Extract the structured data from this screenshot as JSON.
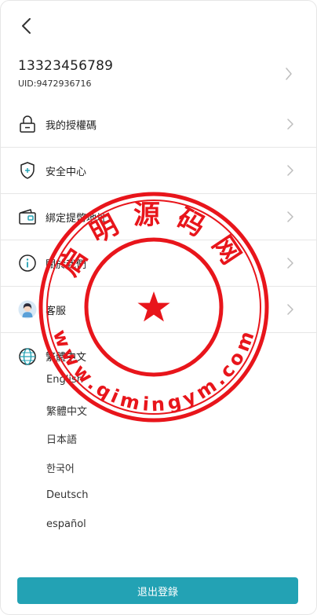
{
  "profile": {
    "phone": "13323456789",
    "uid": "UID:9472936716"
  },
  "menu": [
    {
      "label": "我的授權碼",
      "icon": "lock-icon"
    },
    {
      "label": "安全中心",
      "icon": "shield-icon"
    },
    {
      "label": "綁定提幣地址",
      "icon": "wallet-icon"
    },
    {
      "label": "關於我們",
      "icon": "info-icon"
    },
    {
      "label": "客服",
      "icon": "support-avatar-icon"
    }
  ],
  "language": {
    "current": "繁體中文",
    "icon": "globe-icon",
    "options": [
      "English",
      "繁體中文",
      "日本語",
      "한국어",
      "Deutsch",
      "español"
    ]
  },
  "logout_label": "退出登錄",
  "watermark": {
    "top_text": "启明源码网",
    "bottom_text": "www.qimingym.com",
    "color": "#e8151b"
  },
  "colors": {
    "accent": "#23a2b4",
    "divider": "#e6e6e6"
  }
}
